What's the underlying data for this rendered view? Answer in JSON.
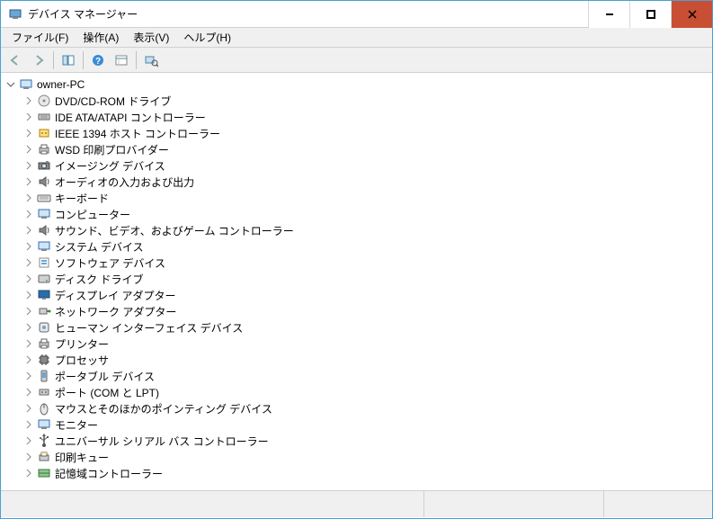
{
  "window": {
    "title": "デバイス マネージャー"
  },
  "menu": {
    "file": "ファイル(F)",
    "action": "操作(A)",
    "view": "表示(V)",
    "help": "ヘルプ(H)"
  },
  "tree": {
    "root": {
      "label": "owner-PC"
    },
    "categories": [
      {
        "label": "DVD/CD-ROM ドライブ",
        "icon": "optical"
      },
      {
        "label": "IDE ATA/ATAPI コントローラー",
        "icon": "ide"
      },
      {
        "label": "IEEE 1394 ホスト コントローラー",
        "icon": "firewire"
      },
      {
        "label": "WSD 印刷プロバイダー",
        "icon": "printer"
      },
      {
        "label": "イメージング デバイス",
        "icon": "imaging"
      },
      {
        "label": "オーディオの入力および出力",
        "icon": "audio"
      },
      {
        "label": "キーボード",
        "icon": "keyboard"
      },
      {
        "label": "コンピューター",
        "icon": "computer"
      },
      {
        "label": "サウンド、ビデオ、およびゲーム コントローラー",
        "icon": "audio"
      },
      {
        "label": "システム デバイス",
        "icon": "computer"
      },
      {
        "label": "ソフトウェア デバイス",
        "icon": "software"
      },
      {
        "label": "ディスク ドライブ",
        "icon": "disk"
      },
      {
        "label": "ディスプレイ アダプター",
        "icon": "display"
      },
      {
        "label": "ネットワーク アダプター",
        "icon": "network"
      },
      {
        "label": "ヒューマン インターフェイス デバイス",
        "icon": "hid"
      },
      {
        "label": "プリンター",
        "icon": "printer"
      },
      {
        "label": "プロセッサ",
        "icon": "cpu"
      },
      {
        "label": "ポータブル デバイス",
        "icon": "portable"
      },
      {
        "label": "ポート (COM と LPT)",
        "icon": "port"
      },
      {
        "label": "マウスとそのほかのポインティング デバイス",
        "icon": "mouse"
      },
      {
        "label": "モニター",
        "icon": "monitor"
      },
      {
        "label": "ユニバーサル シリアル バス コントローラー",
        "icon": "usb"
      },
      {
        "label": "印刷キュー",
        "icon": "printqueue"
      },
      {
        "label": "記憶域コントローラー",
        "icon": "storage"
      }
    ]
  }
}
